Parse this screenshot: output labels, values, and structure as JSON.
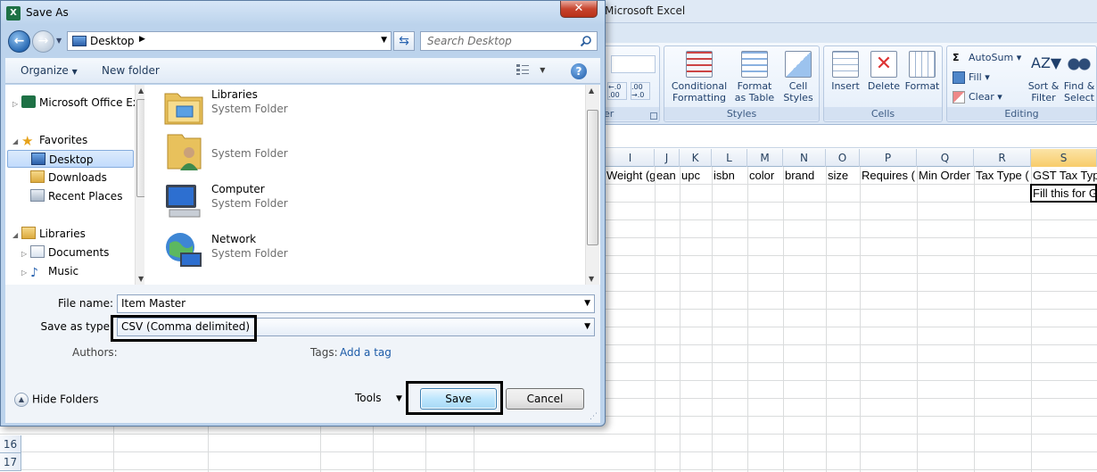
{
  "excel": {
    "title": "Microsoft Excel",
    "ribbon": {
      "styles_group": {
        "label": "Styles",
        "conditional_formatting": "Conditional Formatting",
        "format_as_table": "Format as Table",
        "cell_styles": "Cell Styles"
      },
      "cells_group": {
        "label": "Cells",
        "insert": "Insert",
        "delete": "Delete",
        "format": "Format"
      },
      "editing_group": {
        "label": "Editing",
        "autosum": "AutoSum",
        "fill": "Fill",
        "clear": "Clear",
        "sort_filter": "Sort & Filter",
        "find_select": "Find & Select"
      },
      "number_group_partial_label": "er"
    },
    "columns": [
      "I",
      "J",
      "K",
      "L",
      "M",
      "N",
      "O",
      "P",
      "Q",
      "R",
      "S"
    ],
    "header_row": [
      "Weight (g",
      "ean",
      "upc",
      "isbn",
      "color",
      "brand",
      "size",
      "Requires (",
      "Min Order",
      "Tax Type (",
      "GST Tax Typ"
    ],
    "second_row_s": "Fill this for G",
    "row_numbers": [
      "16",
      "17"
    ]
  },
  "dialog": {
    "title": "Save As",
    "close_label": "✕",
    "address": "Desktop",
    "search_placeholder": "Search Desktop",
    "toolbar": {
      "organize": "Organize",
      "new_folder": "New folder",
      "help": "?"
    },
    "nav_items": [
      {
        "label": "Microsoft Office Ex"
      },
      {
        "label": "Favorites"
      },
      {
        "label": "Desktop"
      },
      {
        "label": "Downloads"
      },
      {
        "label": "Recent Places"
      },
      {
        "label": "Libraries"
      },
      {
        "label": "Documents"
      },
      {
        "label": "Music"
      }
    ],
    "files": [
      {
        "name": "Libraries",
        "type": "System Folder"
      },
      {
        "name": "",
        "type": "System Folder"
      },
      {
        "name": "Computer",
        "type": "System Folder"
      },
      {
        "name": "Network",
        "type": "System Folder"
      }
    ],
    "file_name_label": "File name:",
    "file_name_value": "Item Master",
    "save_as_type_label": "Save as type:",
    "save_as_type_value": "CSV (Comma delimited)",
    "authors_label": "Authors:",
    "tags_label": "Tags:",
    "tags_link": "Add a tag",
    "hide_folders": "Hide Folders",
    "tools": "Tools",
    "save": "Save",
    "cancel": "Cancel"
  }
}
